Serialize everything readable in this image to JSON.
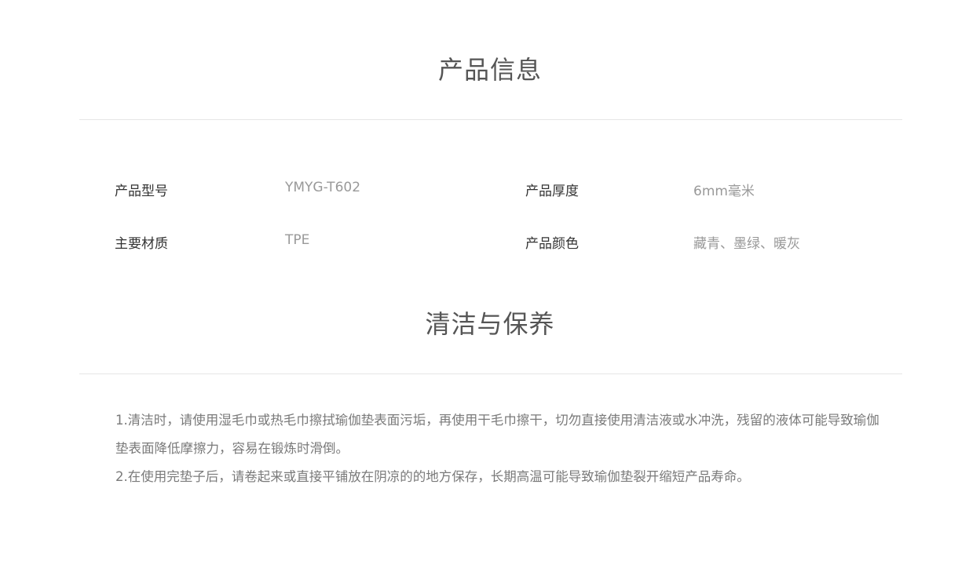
{
  "product_info": {
    "title": "产品信息",
    "specs": [
      {
        "label": "产品型号",
        "value": "YMYG-T602"
      },
      {
        "label": "产品厚度",
        "value": "6mm毫米"
      },
      {
        "label": "主要材质",
        "value": "TPE"
      },
      {
        "label": "产品颜色",
        "value": "藏青、墨绿、暖灰"
      }
    ]
  },
  "care": {
    "title": "清洁与保养",
    "items": [
      "1.清洁时，请使用湿毛巾或热毛巾擦拭瑜伽垫表面污垢，再使用干毛巾擦干，切勿直接使用清洁液或水冲洗，残留的液体可能导致瑜伽垫表面降低摩擦力，容易在锻炼时滑倒。",
      "2.在使用完垫子后，请卷起来或直接平铺放在阴凉的的地方保存，长期高温可能导致瑜伽垫裂开缩短产品寿命。"
    ]
  }
}
